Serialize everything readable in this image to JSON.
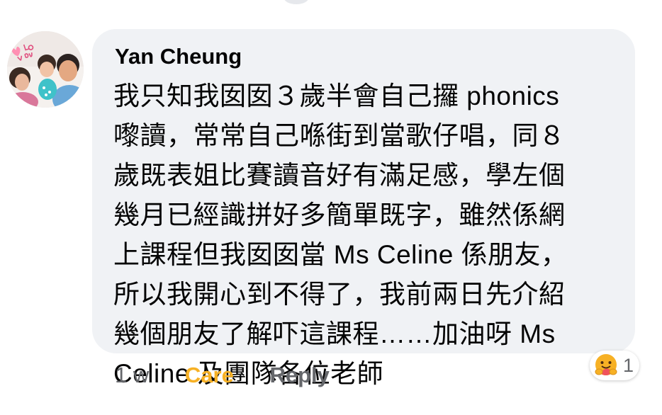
{
  "comment": {
    "author": "Yan Cheung",
    "lines": [
      "我只知我囡囡３歲半會自己攞 phonics",
      "嚟讀，常常自己喺街到當歌仔唱，同８",
      "歲既表姐比賽讀音好有滿足感，學左個",
      "幾月已經識拼好多簡單既字，雖然係網",
      "上課程但我囡囡當 Ms Celine 係朋友，",
      "所以我開心到不得了，我前兩日先介紹",
      "幾個朋友了解吓這課程……加油呀 Ms",
      "Celine 及團隊各位老師"
    ]
  },
  "actions": {
    "time": "1 w",
    "care_label": "Care",
    "reply_label": "Reply"
  },
  "reactions": {
    "icon": "care-hug-emoji",
    "count": "1"
  },
  "avatar": {
    "sticker_text": "Love you"
  },
  "colors": {
    "bubble": "#f0f2f5",
    "text": "#050505",
    "muted": "#65676b",
    "care": "#f7b125"
  }
}
